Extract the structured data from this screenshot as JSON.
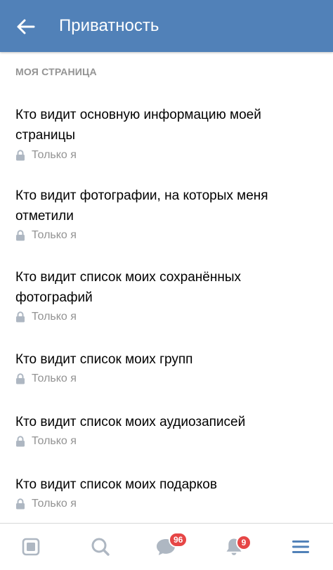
{
  "header": {
    "title": "Приватность",
    "back_icon": "arrow-left-icon",
    "background": "#5181b8"
  },
  "section": {
    "title": "МОЯ СТРАНИЦА"
  },
  "settings": [
    {
      "label": "Кто видит основную информацию моей страницы",
      "value": "Только я",
      "icon": "lock-icon"
    },
    {
      "label": "Кто видит фотографии, на которых меня отметили",
      "value": "Только я",
      "icon": "lock-icon"
    },
    {
      "label": "Кто видит список моих сохранённых фотографий",
      "value": "Только я",
      "icon": "lock-icon"
    },
    {
      "label": "Кто видит список моих групп",
      "value": "Только я",
      "icon": "lock-icon"
    },
    {
      "label": "Кто видит список моих аудиозаписей",
      "value": "Только я",
      "icon": "lock-icon"
    },
    {
      "label": "Кто видит список моих подарков",
      "value": "Только я",
      "icon": "lock-icon"
    }
  ],
  "tabbar": {
    "tabs": [
      {
        "icon": "news-icon"
      },
      {
        "icon": "search-icon"
      },
      {
        "icon": "messages-icon",
        "badge": "96"
      },
      {
        "icon": "notifications-bell-icon",
        "badge": "9"
      },
      {
        "icon": "menu-icon",
        "active": true
      }
    ]
  },
  "colors": {
    "accent": "#5181b8",
    "muted_text": "#939393",
    "icon_inactive": "#aeb7c2",
    "badge": "#e64646"
  }
}
